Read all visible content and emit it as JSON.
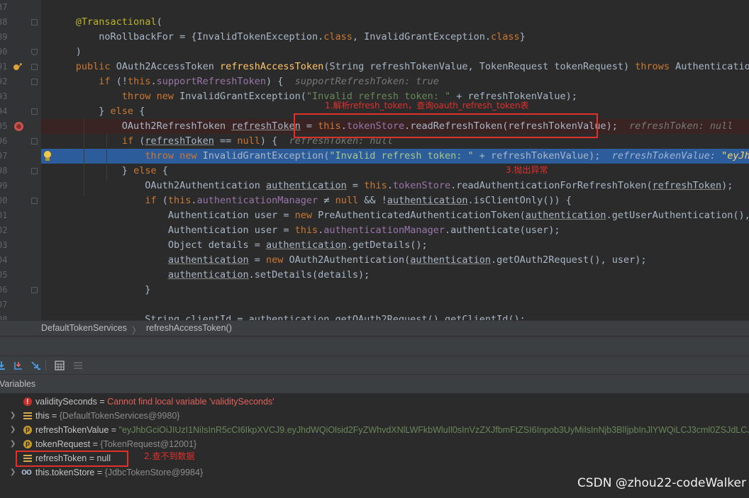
{
  "editor": {
    "lines": [
      {
        "num": "37",
        "tokens": []
      },
      {
        "num": "38",
        "tokens": [
          {
            "t": "    "
          },
          {
            "t": "@Transactional",
            "c": "an"
          },
          {
            "t": "("
          }
        ]
      },
      {
        "num": "89",
        "tokens": [
          {
            "t": "        noRollbackFor = {InvalidTokenException."
          },
          {
            "t": "class",
            "c": "kw"
          },
          {
            "t": ", InvalidGrantException."
          },
          {
            "t": "class",
            "c": "kw"
          },
          {
            "t": "}"
          }
        ]
      },
      {
        "num": "90",
        "tokens": [
          {
            "t": "    )"
          }
        ]
      },
      {
        "num": "91",
        "tokens": [
          {
            "t": "    "
          },
          {
            "t": "public ",
            "c": "kw"
          },
          {
            "t": "OAuth2AccessToken "
          },
          {
            "t": "refreshAccessToken",
            "c": "mt"
          },
          {
            "t": "(String refreshTokenValue, TokenRequest tokenRequest) "
          },
          {
            "t": "throws ",
            "c": "kw"
          },
          {
            "t": "AuthenticationExce"
          }
        ]
      },
      {
        "num": "92",
        "tokens": [
          {
            "t": "        "
          },
          {
            "t": "if ",
            "c": "kw"
          },
          {
            "t": "(!"
          },
          {
            "t": "this",
            "c": "kw"
          },
          {
            "t": "."
          },
          {
            "t": "supportRefreshToken",
            "c": "fld"
          },
          {
            "t": ") {  "
          },
          {
            "t": "supportRefreshToken: true",
            "c": "inl"
          }
        ]
      },
      {
        "num": "93",
        "tokens": [
          {
            "t": "            "
          },
          {
            "t": "throw new ",
            "c": "kw"
          },
          {
            "t": "InvalidGrantException("
          },
          {
            "t": "\"Invalid refresh token: \"",
            "c": "str"
          },
          {
            "t": " + refreshTokenValue);"
          }
        ]
      },
      {
        "num": "94",
        "tokens": [
          {
            "t": "        } "
          },
          {
            "t": "else ",
            "c": "kw"
          },
          {
            "t": "{"
          }
        ]
      },
      {
        "num": "95",
        "tokens": [
          {
            "t": "            OAuth2RefreshToken "
          },
          {
            "t": "refreshToken",
            "c": "ul"
          },
          {
            "t": " = "
          },
          {
            "t": "this",
            "c": "kw"
          },
          {
            "t": "."
          },
          {
            "t": "tokenStore",
            "c": "fld"
          },
          {
            "t": ".readRefreshToken(refreshTokenValue);  "
          },
          {
            "t": "refreshToken: null   tok",
            "c": "inl"
          }
        ]
      },
      {
        "num": "96",
        "tokens": [
          {
            "t": "            "
          },
          {
            "t": "if ",
            "c": "kw"
          },
          {
            "t": "("
          },
          {
            "t": "refreshToken",
            "c": "ul"
          },
          {
            "t": " == "
          },
          {
            "t": "null",
            "c": "kw"
          },
          {
            "t": ") {  "
          },
          {
            "t": "refreshToken: null",
            "c": "inl"
          }
        ]
      },
      {
        "num": "97",
        "tokens": [
          {
            "t": "                "
          },
          {
            "t": "throw new ",
            "c": "kw"
          },
          {
            "t": "InvalidGrantException("
          },
          {
            "t": "\"Invalid refresh token: \"",
            "c": "str"
          },
          {
            "t": " + refreshTokenValue);  "
          },
          {
            "t": "refreshTokenValue: ",
            "c": "inl"
          },
          {
            "t": "\"eyJhbGci",
            "c": "inl-s"
          }
        ]
      },
      {
        "num": "98",
        "tokens": [
          {
            "t": "            } "
          },
          {
            "t": "else ",
            "c": "kw"
          },
          {
            "t": "{"
          }
        ]
      },
      {
        "num": "99",
        "tokens": [
          {
            "t": "                OAuth2Authentication "
          },
          {
            "t": "authentication",
            "c": "ul"
          },
          {
            "t": " = "
          },
          {
            "t": "this",
            "c": "kw"
          },
          {
            "t": "."
          },
          {
            "t": "tokenStore",
            "c": "fld"
          },
          {
            "t": ".readAuthenticationForRefreshToken("
          },
          {
            "t": "refreshToken",
            "c": "ul"
          },
          {
            "t": ");"
          }
        ]
      },
      {
        "num": "00",
        "tokens": [
          {
            "t": "                "
          },
          {
            "t": "if ",
            "c": "kw"
          },
          {
            "t": "("
          },
          {
            "t": "this",
            "c": "kw"
          },
          {
            "t": "."
          },
          {
            "t": "authenticationManager",
            "c": "fld"
          },
          {
            "t": " ≠ "
          },
          {
            "t": "null",
            "c": "kw"
          },
          {
            "t": " && !"
          },
          {
            "t": "authentication",
            "c": "ul"
          },
          {
            "t": ".isClientOnly()) {"
          }
        ]
      },
      {
        "num": "01",
        "tokens": [
          {
            "t": "                    Authentication user = "
          },
          {
            "t": "new ",
            "c": "kw"
          },
          {
            "t": "PreAuthenticatedAuthenticationToken("
          },
          {
            "t": "authentication",
            "c": "ul"
          },
          {
            "t": ".getUserAuthentication(),  "
          },
          {
            "t": "aCr",
            "c": "inl-box"
          }
        ]
      },
      {
        "num": "02",
        "tokens": [
          {
            "t": "                    Authentication user = "
          },
          {
            "t": "this",
            "c": "kw"
          },
          {
            "t": "."
          },
          {
            "t": "authenticationManager",
            "c": "fld"
          },
          {
            "t": ".authenticate(user);"
          }
        ]
      },
      {
        "num": "03",
        "tokens": [
          {
            "t": "                    Object details = "
          },
          {
            "t": "authentication",
            "c": "ul"
          },
          {
            "t": ".getDetails();"
          }
        ]
      },
      {
        "num": "04",
        "tokens": [
          {
            "t": "                    "
          },
          {
            "t": "authentication",
            "c": "ul"
          },
          {
            "t": " = "
          },
          {
            "t": "new ",
            "c": "kw"
          },
          {
            "t": "OAuth2Authentication("
          },
          {
            "t": "authentication",
            "c": "ul"
          },
          {
            "t": ".getOAuth2Request(), user);"
          }
        ]
      },
      {
        "num": "05",
        "tokens": [
          {
            "t": "                    "
          },
          {
            "t": "authentication",
            "c": "ul"
          },
          {
            "t": ".setDetails(details);"
          }
        ]
      },
      {
        "num": "06",
        "tokens": [
          {
            "t": "                }"
          }
        ]
      },
      {
        "num": "07",
        "tokens": []
      },
      {
        "num": "08",
        "tokens": [
          {
            "t": "                String clientId = authentication.getOAuth2Request().getClientId();"
          }
        ]
      }
    ]
  },
  "annotations": {
    "note1": "1.解析refresh_token，查询oauth_refresh_token表",
    "note2": "2.查不到数据",
    "note3": "3.抛出异常"
  },
  "breadcrumb": {
    "class_name": "DefaultTokenServices",
    "separator": "〉",
    "method_name": "refreshAccessToken()"
  },
  "variables_panel": {
    "title": "Variables",
    "items": [
      {
        "icon": "error",
        "name": "validitySeconds",
        "eq": " = ",
        "value": "Cannot find local variable 'validitySeconds'",
        "vclass": "vval-err",
        "expandable": false
      },
      {
        "icon": "field",
        "name": "this",
        "eq": " = ",
        "value": "{DefaultTokenServices@9980}",
        "vclass": "vval-obj",
        "expandable": true
      },
      {
        "icon": "param",
        "name": "refreshTokenValue",
        "eq": " = ",
        "value": "\"eyJhbGciOiJIUzI1NiIsInR5cCI6IkpXVCJ9.eyJhdWQiOlsid2FyZWhvdXNlLWFkbWluIl0sInVzZXJfbmFtZSI6Inpob3UyMiIsInNjb3BlIjpbInJlYWQiLCJ3cml0ZSJdLCJhd",
        "vclass": "vval-str",
        "expandable": true
      },
      {
        "icon": "param",
        "name": "tokenRequest",
        "eq": " = ",
        "value": "{TokenRequest@12001}",
        "vclass": "vval-obj",
        "expandable": true
      },
      {
        "icon": "field",
        "name": "refreshToken",
        "eq": " = ",
        "value": "null",
        "vclass": "vval-null",
        "expandable": false
      },
      {
        "icon": "watch",
        "name": "this.tokenStore",
        "eq": " = ",
        "value": "{JdbcTokenStore@9984}",
        "vclass": "vval-obj",
        "expandable": true
      }
    ]
  },
  "watermark": "CSDN @zhou22-codeWalker",
  "colors": {
    "execution_line": "#2d5c9b",
    "breakpoint_line": "#3a2323",
    "annotation_red": "#e0302c"
  }
}
